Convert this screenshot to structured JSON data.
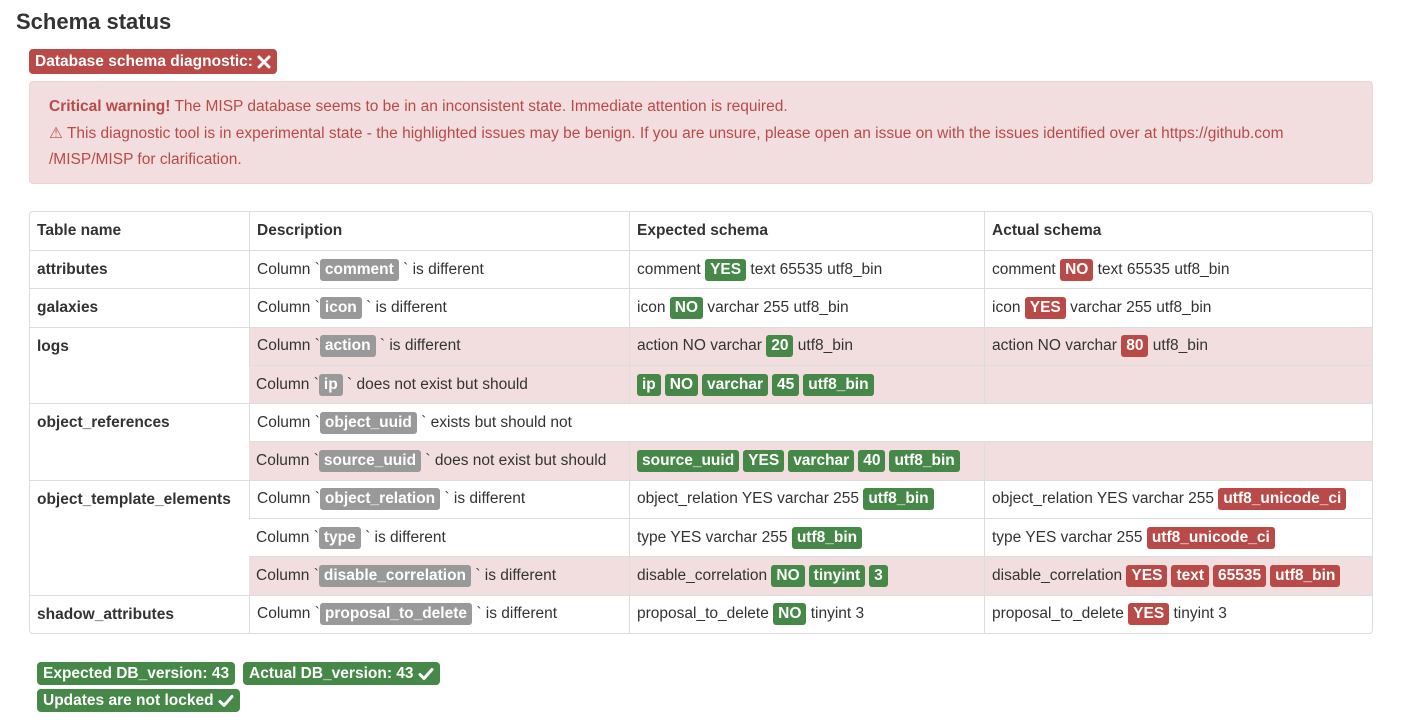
{
  "page": {
    "title": "Schema status"
  },
  "diagnostic_badge": {
    "label": "Database schema diagnostic:",
    "icon": "cross-icon"
  },
  "alert": {
    "heading": "Critical warning!",
    "message": "The MISP database seems to be in an inconsistent state. Immediate attention is required.",
    "warning_symbol": "⚠",
    "warning_line1": "This diagnostic tool is in experimental state - the highlighted issues may be benign. If you are unsure, please open an issue on with the issues identified over at https://github.com",
    "warning_line2": "/MISP/MISP for clarification."
  },
  "table": {
    "headers": [
      "Table name",
      "Description",
      "Expected schema",
      "Actual schema"
    ],
    "column_prefix": "Column `",
    "rows": [
      {
        "table": "attributes",
        "column": "comment",
        "desc_suffix": "` is different",
        "expected": {
          "prefix": "comment",
          "badge": "YES",
          "suffix": "text 65535 utf8_bin"
        },
        "actual": {
          "prefix": "comment",
          "badge": "NO",
          "suffix": "text 65535 utf8_bin"
        }
      },
      {
        "table": "galaxies",
        "column": "icon",
        "desc_suffix": "` is different",
        "expected": {
          "prefix": "icon",
          "badge": "NO",
          "suffix": "varchar 255 utf8_bin"
        },
        "actual": {
          "prefix": "icon",
          "badge": "YES",
          "suffix": "varchar 255 utf8_bin"
        }
      },
      {
        "table": "logs",
        "column": "action",
        "desc_suffix": "` is different",
        "expected": {
          "prefix": "action NO varchar",
          "badge": "20",
          "suffix": "utf8_bin"
        },
        "actual": {
          "prefix": "action NO varchar",
          "badge": "80",
          "suffix": "utf8_bin"
        }
      },
      {
        "column": "ip",
        "desc_suffix": "` does not exist but should",
        "expected_badges": [
          "ip",
          "NO",
          "varchar",
          "45",
          "utf8_bin"
        ]
      },
      {
        "table": "object_references",
        "column": "object_uuid",
        "desc_suffix": "` exists but should not"
      },
      {
        "column": "source_uuid",
        "desc_suffix": "` does not exist but should",
        "expected_badges": [
          "source_uuid",
          "YES",
          "varchar",
          "40",
          "utf8_bin"
        ]
      },
      {
        "table": "object_template_elements",
        "column": "object_relation",
        "desc_suffix": "` is different",
        "expected": {
          "prefix": "object_relation YES varchar 255",
          "badge": "utf8_bin"
        },
        "actual": {
          "prefix": "object_relation YES varchar 255",
          "badge": "utf8_unicode_ci"
        }
      },
      {
        "column": "type",
        "desc_suffix": "` is different",
        "expected": {
          "prefix": "type YES varchar 255",
          "badge": "utf8_bin"
        },
        "actual": {
          "prefix": "type YES varchar 255",
          "badge": "utf8_unicode_ci"
        }
      },
      {
        "column": "disable_correlation",
        "desc_suffix": "` is different",
        "expected": {
          "prefix": "disable_correlation",
          "badges": [
            "NO",
            "tinyint",
            "3"
          ]
        },
        "actual": {
          "prefix": "disable_correlation",
          "badges": [
            "YES",
            "text",
            "65535",
            "utf8_bin"
          ]
        }
      },
      {
        "table": "shadow_attributes",
        "column": "proposal_to_delete",
        "desc_suffix": "` is different",
        "expected": {
          "prefix": "proposal_to_delete",
          "badge": "NO",
          "suffix": "tinyint 3"
        },
        "actual": {
          "prefix": "proposal_to_delete",
          "badge": "YES",
          "suffix": "tinyint 3"
        }
      }
    ]
  },
  "footer": {
    "expected_version": "Expected DB_version: 43",
    "actual_version": "Actual DB_version: 43",
    "updates_status": "Updates are not locked",
    "check_icon": "check-icon"
  },
  "colors": {
    "success": "#468847",
    "danger": "#b94a48",
    "muted": "#999999",
    "alert_bg": "#f2dede",
    "border": "#dddddd"
  }
}
